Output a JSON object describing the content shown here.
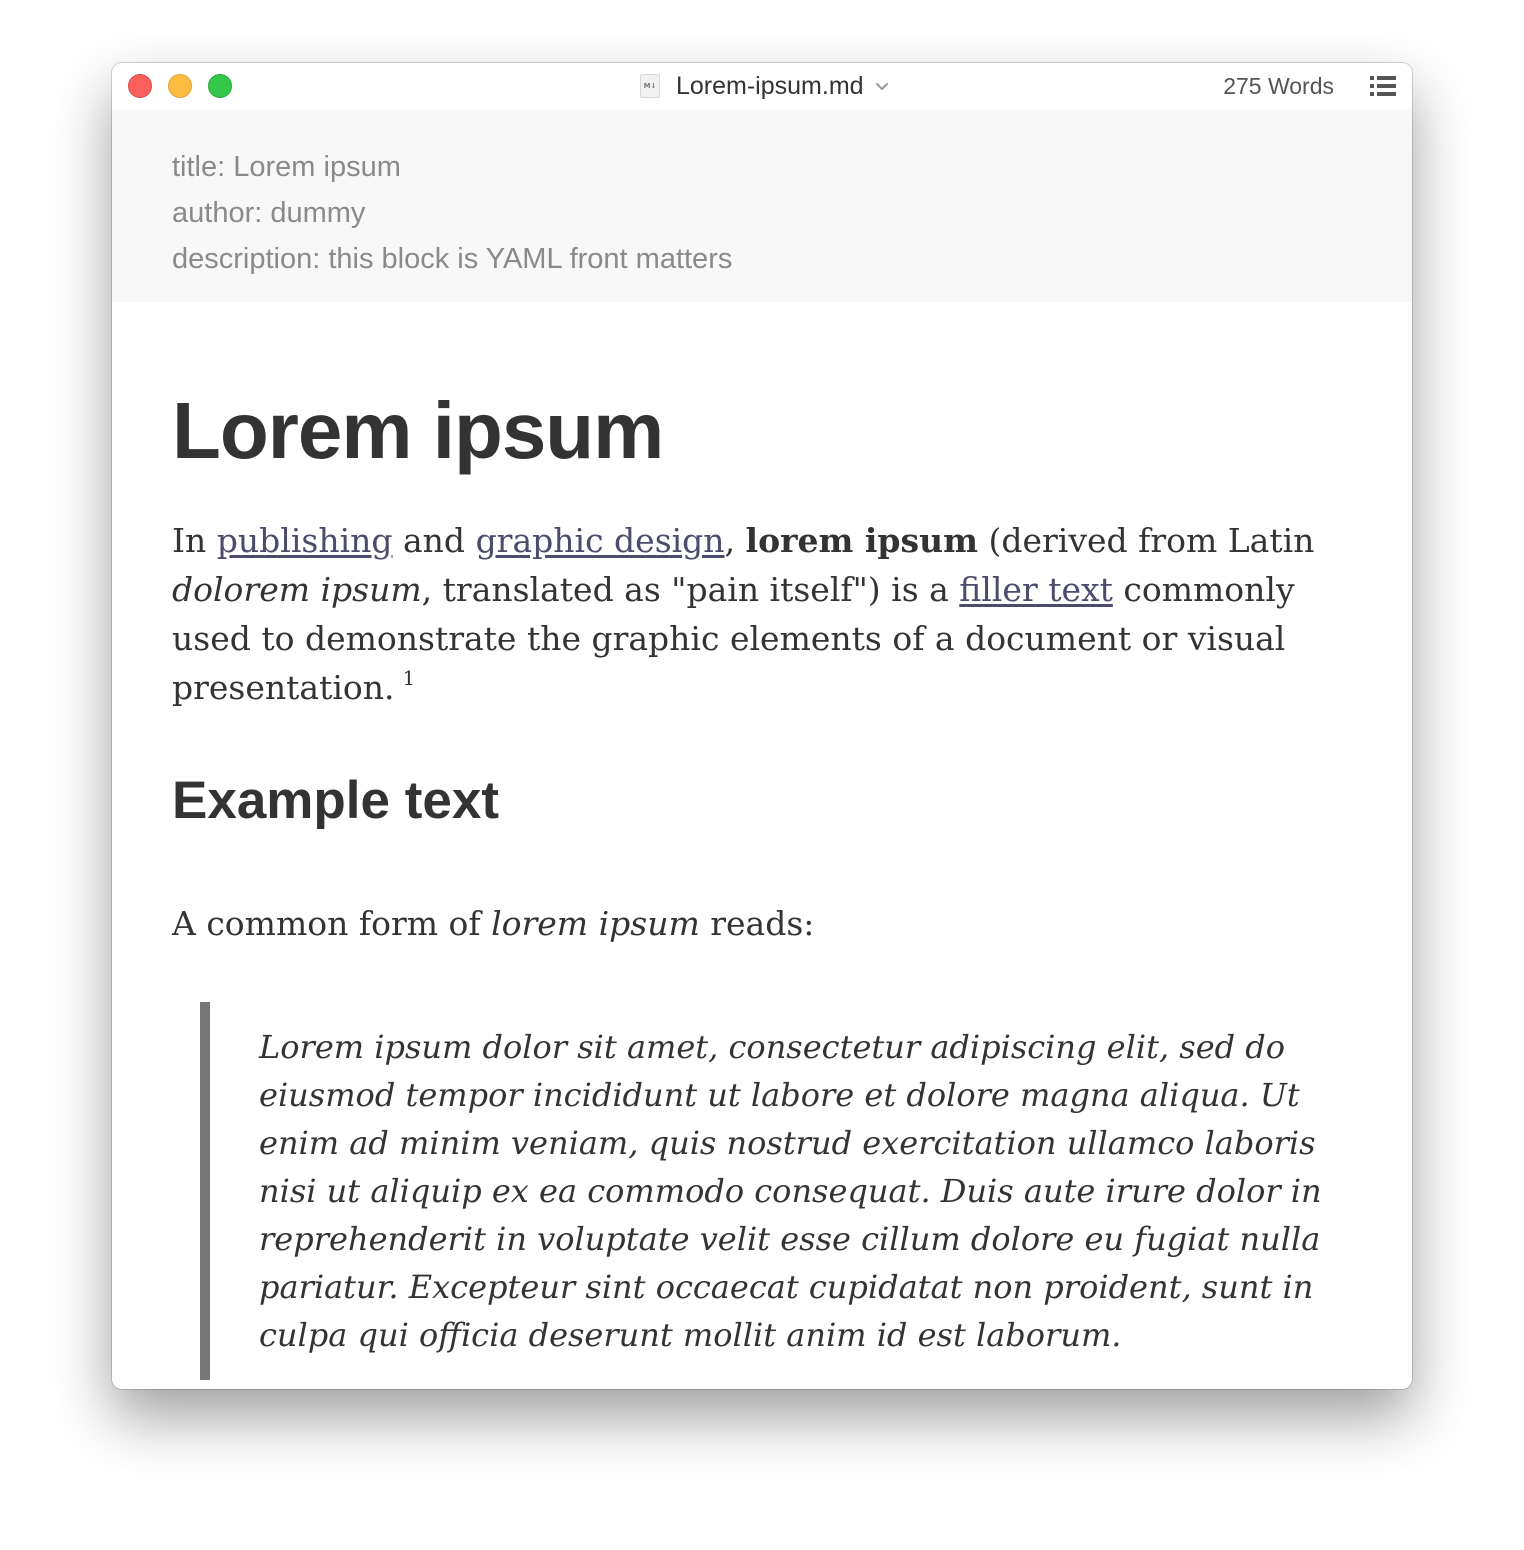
{
  "window": {
    "filename": "Lorem-ipsum.md",
    "file_badge": "M↓",
    "word_count": "275 Words"
  },
  "front_matter": {
    "lines": [
      "title: Lorem ipsum",
      "author: dummy",
      "description: this block is YAML front matters"
    ]
  },
  "document": {
    "heading1": "Lorem ipsum",
    "intro": {
      "t1": "In ",
      "link1": "publishing",
      "t2": " and ",
      "link2": "graphic design",
      "t3": ", ",
      "bold": "lorem ipsum",
      "t4": " (derived from Latin ",
      "italic": "dolorem ipsum",
      "t5": ", translated as \"pain itself\") is a ",
      "link3": "filler text",
      "t6": " commonly used to demonstrate the graphic elements of a document or visual presentation.",
      "footnote": "1"
    },
    "heading2": "Example text",
    "example_intro": {
      "t1": "A common form of ",
      "italic": "lorem ipsum",
      "t2": " reads:"
    },
    "blockquote": "Lorem ipsum dolor sit amet, consectetur adipiscing elit, sed do eiusmod tempor incididunt ut labore et dolore magna aliqua. Ut enim ad minim veniam, quis nostrud exercitation ullamco laboris nisi ut aliquip ex ea commodo consequat. Duis aute irure dolor in reprehenderit in voluptate velit esse cillum dolore eu fugiat nulla pariatur. Excepteur sint occaecat cupidatat non proident, sunt in culpa qui officia deserunt mollit anim id est laborum."
  },
  "colors": {
    "close": "#fc605c",
    "minimize": "#fdbc40",
    "zoom": "#34c84a",
    "text": "#333333",
    "link": "#4b4b6b",
    "front_matter_bg": "#f8f8f8",
    "blockquote_bar": "#777777"
  },
  "icons": {
    "close": "close-button",
    "minimize": "minimize-button",
    "zoom": "zoom-button",
    "dropdown": "chevron-down-icon",
    "outline": "outline-list-icon",
    "file": "markdown-file-icon"
  }
}
